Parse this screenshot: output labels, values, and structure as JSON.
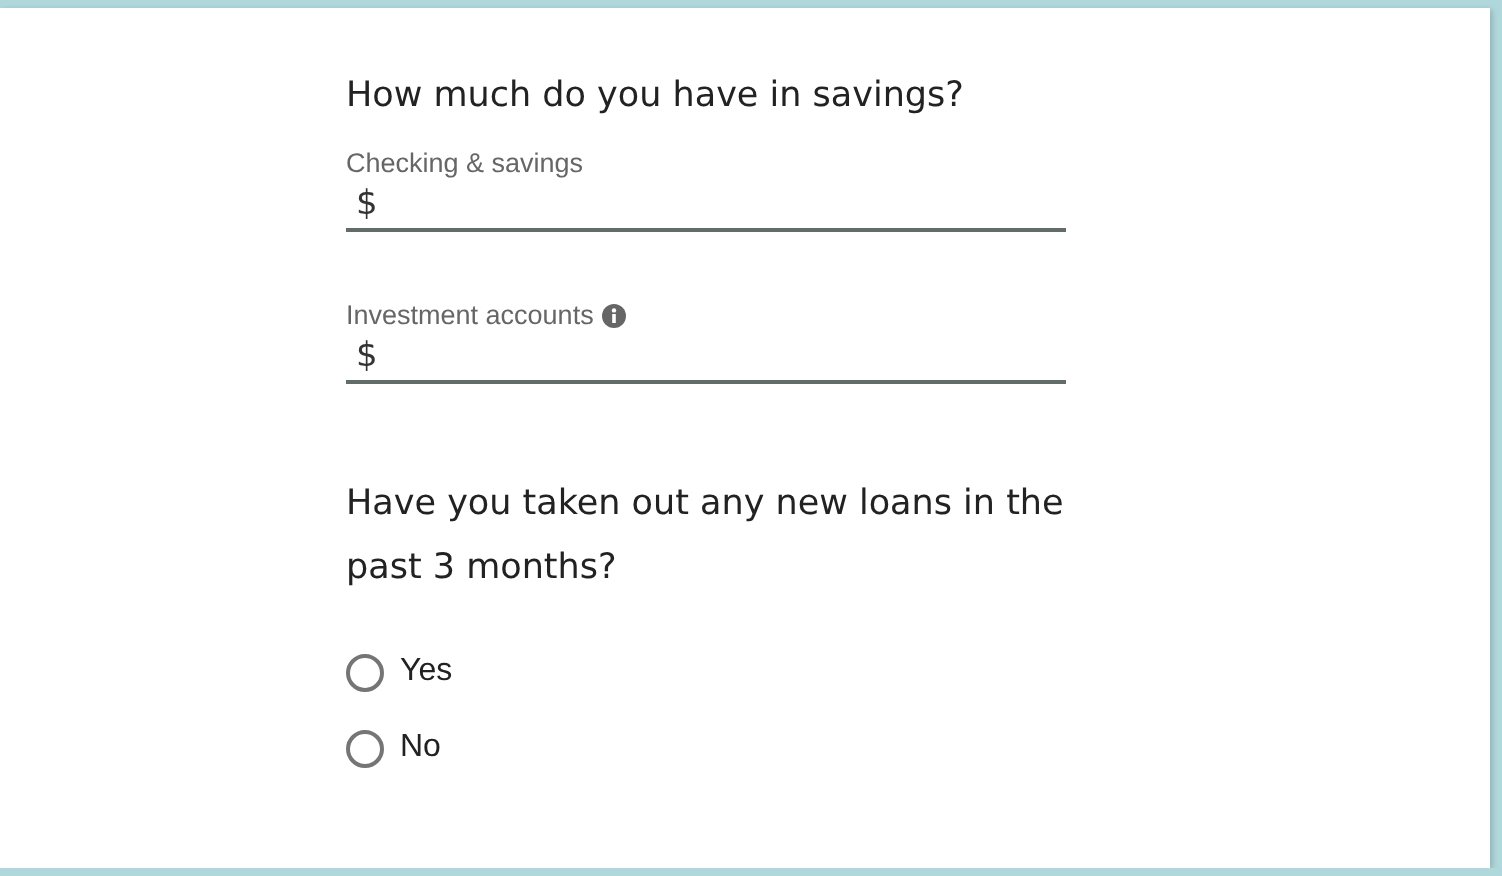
{
  "savings": {
    "heading": "How much do you have in savings?",
    "fields": [
      {
        "label": "Checking & savings",
        "prefix": "$",
        "info": false
      },
      {
        "label": "Investment accounts",
        "prefix": "$",
        "info": true
      }
    ]
  },
  "loans": {
    "heading": "Have you taken out any new loans in the past 3 months?",
    "options": [
      {
        "label": "Yes",
        "selected": false
      },
      {
        "label": "No",
        "selected": false
      }
    ]
  }
}
